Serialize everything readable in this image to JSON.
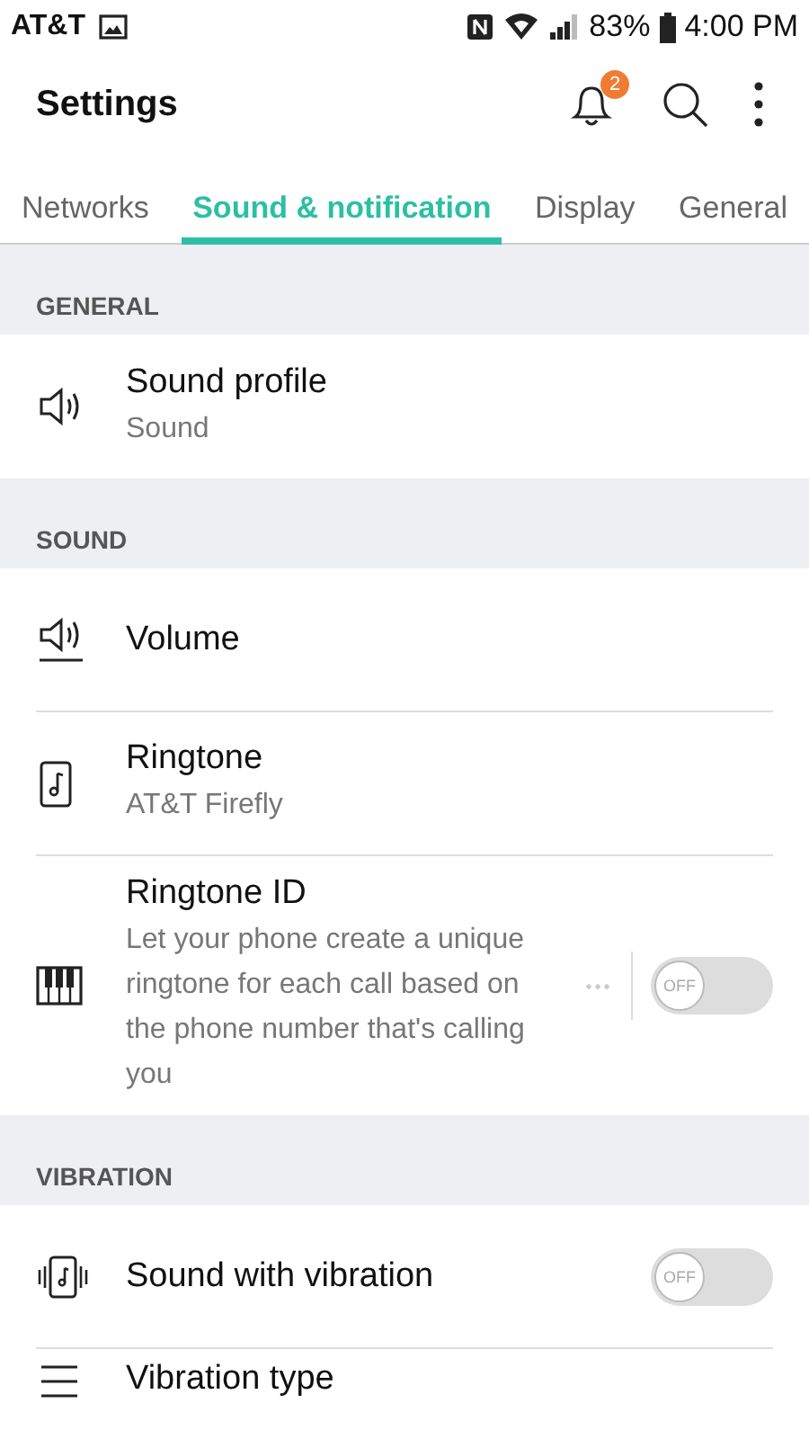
{
  "status_bar": {
    "carrier": "AT&T",
    "battery": "83%",
    "time": "4:00 PM"
  },
  "app_bar": {
    "title": "Settings",
    "notification_count": "2"
  },
  "tabs": [
    {
      "label": "Networks",
      "selected": false
    },
    {
      "label": "Sound & notification",
      "selected": true
    },
    {
      "label": "Display",
      "selected": false
    },
    {
      "label": "General",
      "selected": false
    }
  ],
  "sections": [
    {
      "header": "GENERAL",
      "items": [
        {
          "kind": "nav",
          "title": "Sound profile",
          "subtitle": "Sound"
        }
      ]
    },
    {
      "header": "SOUND",
      "items": [
        {
          "kind": "nav",
          "title": "Volume"
        },
        {
          "kind": "nav",
          "title": "Ringtone",
          "subtitle": "AT&T Firefly"
        },
        {
          "kind": "toggle",
          "title": "Ringtone ID",
          "subtitle": "Let your phone create a unique ringtone for each call based on the phone number that's calling you",
          "more": true,
          "on": false,
          "switch_label": "OFF"
        }
      ]
    },
    {
      "header": "VIBRATION",
      "items": [
        {
          "kind": "toggle",
          "title": "Sound with vibration",
          "more": false,
          "on": false,
          "switch_label": "OFF"
        },
        {
          "kind": "nav",
          "title": "Vibration type"
        }
      ]
    }
  ]
}
